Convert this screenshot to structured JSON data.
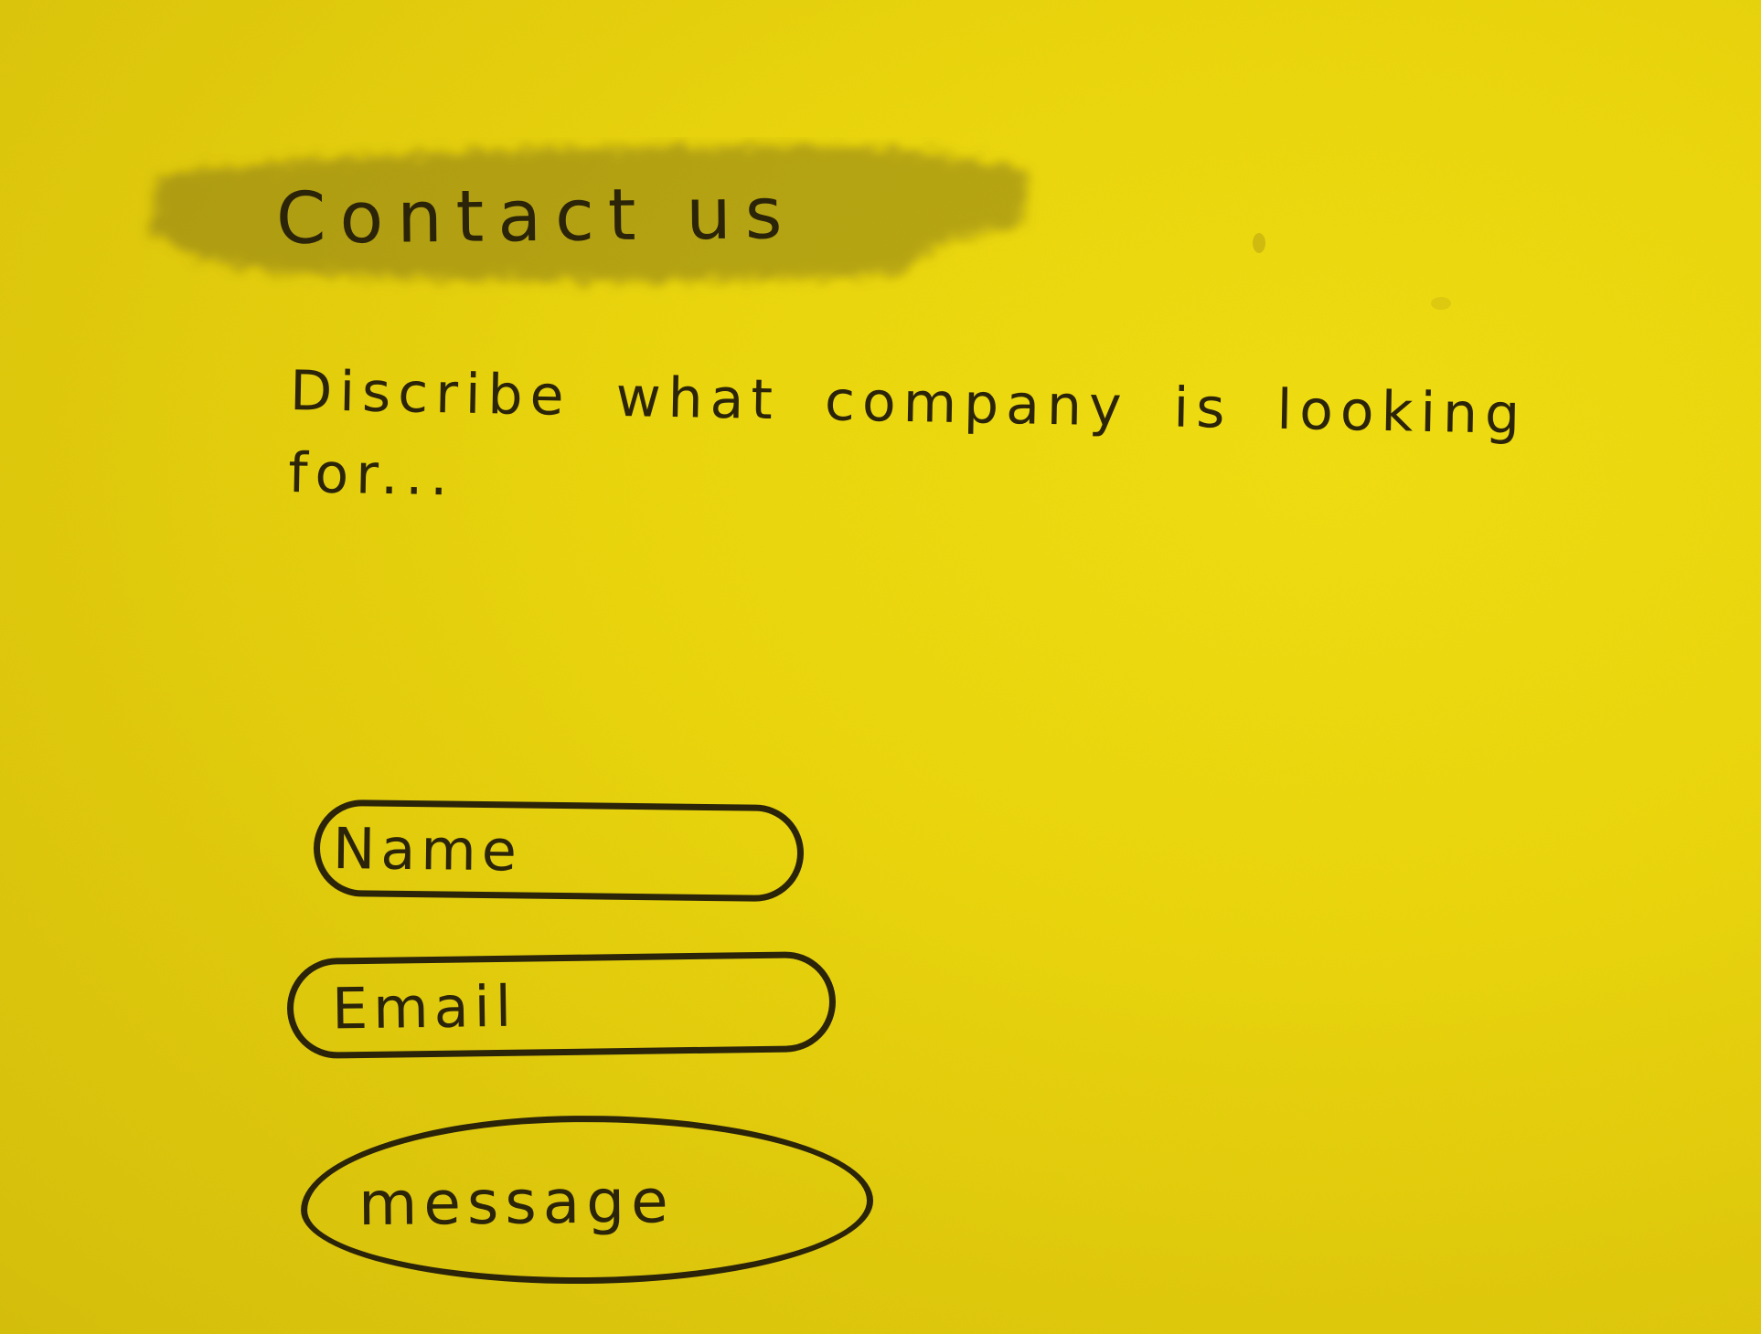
{
  "page": {
    "background_color": "#e8d20c",
    "ink_color": "#2b2408"
  },
  "header": {
    "title": "Contact us"
  },
  "intro": {
    "description": "Discribe what company is looking for..."
  },
  "contact_form": {
    "name_field": {
      "placeholder": "Name",
      "value": ""
    },
    "email_field": {
      "placeholder": "Email",
      "value": ""
    },
    "message_field": {
      "placeholder": "message",
      "value": ""
    }
  }
}
